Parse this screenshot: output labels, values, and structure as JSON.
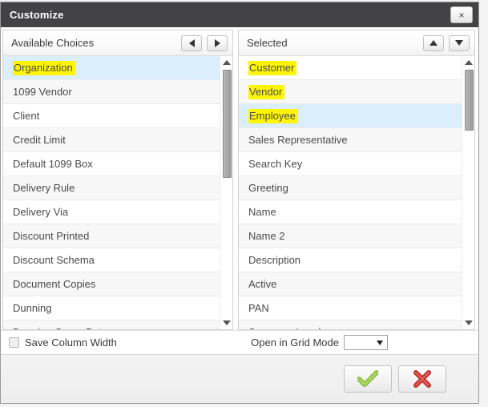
{
  "dialog": {
    "title": "Customize",
    "close_label": "×",
    "close_icon": "close-icon"
  },
  "available": {
    "header": "Available Choices",
    "move_left_icon": "arrow-left-icon",
    "move_right_icon": "arrow-right-icon",
    "scroll_up_icon": "scroll-up-icon",
    "scroll_down_icon": "scroll-down-icon",
    "items": [
      {
        "label": "Organization",
        "selected": true,
        "highlighted": true
      },
      {
        "label": "1099 Vendor",
        "selected": false,
        "highlighted": false
      },
      {
        "label": "Client",
        "selected": false,
        "highlighted": false
      },
      {
        "label": "Credit Limit",
        "selected": false,
        "highlighted": false
      },
      {
        "label": "Default 1099 Box",
        "selected": false,
        "highlighted": false
      },
      {
        "label": "Delivery Rule",
        "selected": false,
        "highlighted": false
      },
      {
        "label": "Delivery Via",
        "selected": false,
        "highlighted": false
      },
      {
        "label": "Discount Printed",
        "selected": false,
        "highlighted": false
      },
      {
        "label": "Discount Schema",
        "selected": false,
        "highlighted": false
      },
      {
        "label": "Document Copies",
        "selected": false,
        "highlighted": false
      },
      {
        "label": "Dunning",
        "selected": false,
        "highlighted": false
      },
      {
        "label": "Dunning Grace Date",
        "selected": false,
        "highlighted": false
      }
    ]
  },
  "selected": {
    "header": "Selected",
    "move_up_icon": "arrow-up-icon",
    "move_down_icon": "arrow-down-icon",
    "scroll_up_icon": "scroll-up-icon",
    "scroll_down_icon": "scroll-down-icon",
    "items": [
      {
        "label": "Customer",
        "selected": false,
        "highlighted": true
      },
      {
        "label": "Vendor",
        "selected": false,
        "highlighted": true
      },
      {
        "label": "Employee",
        "selected": true,
        "highlighted": true
      },
      {
        "label": "Sales Representative",
        "selected": false,
        "highlighted": false
      },
      {
        "label": "Search Key",
        "selected": false,
        "highlighted": false
      },
      {
        "label": "Greeting",
        "selected": false,
        "highlighted": false
      },
      {
        "label": "Name",
        "selected": false,
        "highlighted": false
      },
      {
        "label": "Name 2",
        "selected": false,
        "highlighted": false
      },
      {
        "label": "Description",
        "selected": false,
        "highlighted": false
      },
      {
        "label": "Active",
        "selected": false,
        "highlighted": false
      },
      {
        "label": "PAN",
        "selected": false,
        "highlighted": false
      },
      {
        "label": "Summary Level",
        "selected": false,
        "highlighted": false
      }
    ]
  },
  "options": {
    "save_column_width_label": "Save Column Width",
    "save_column_width_checked": false,
    "grid_mode_label": "Open in Grid Mode",
    "grid_mode_value": "",
    "grid_mode_caret_icon": "chevron-down-icon"
  },
  "footer": {
    "ok_icon": "check-icon",
    "cancel_icon": "cross-icon"
  },
  "colors": {
    "titlebar": "#434345",
    "selection": "#daeefb",
    "highlighter": "#fdf407",
    "ok_green": "#8cbf3f",
    "cancel_red": "#d83a34"
  }
}
